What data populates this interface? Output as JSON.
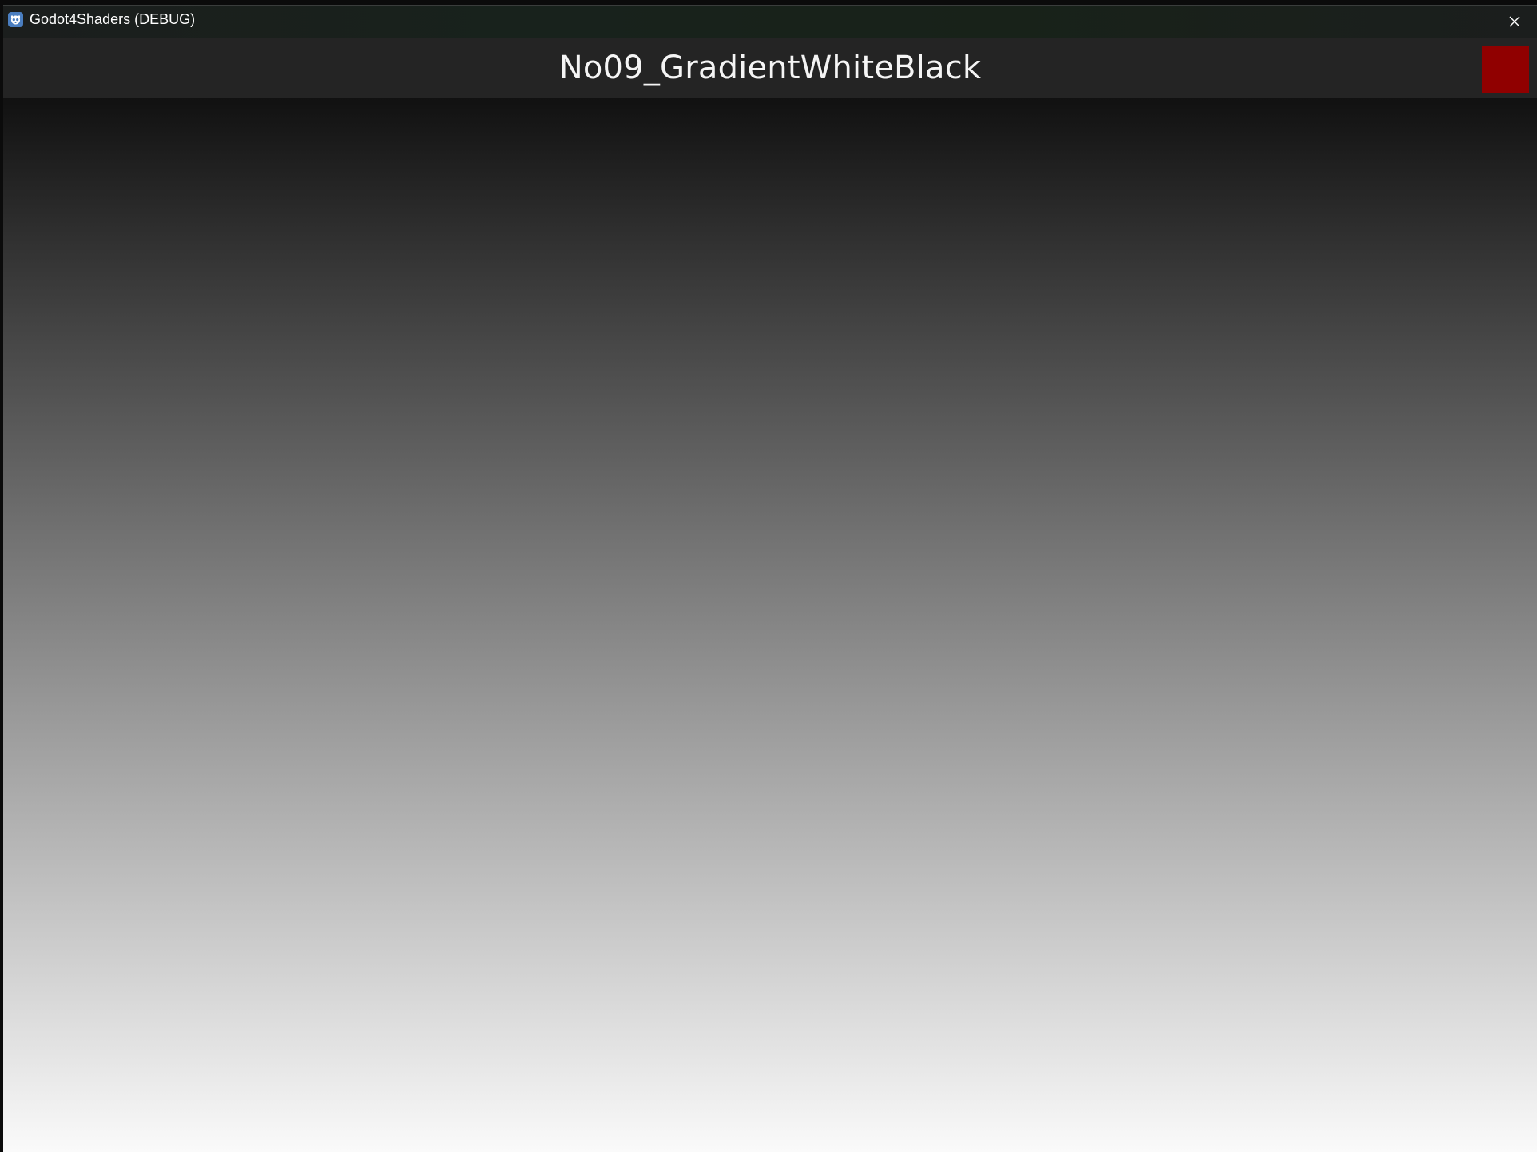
{
  "window": {
    "title": "Godot4Shaders (DEBUG)",
    "icon": "godot-icon",
    "close_icon": "close-icon"
  },
  "header": {
    "scene_title": "No09_GradientWhiteBlack",
    "action_button_color": "#900000"
  },
  "viewport": {
    "gradient_top_color": "#111111",
    "gradient_bottom_color": "#fafafa",
    "direction": "top-to-bottom"
  }
}
